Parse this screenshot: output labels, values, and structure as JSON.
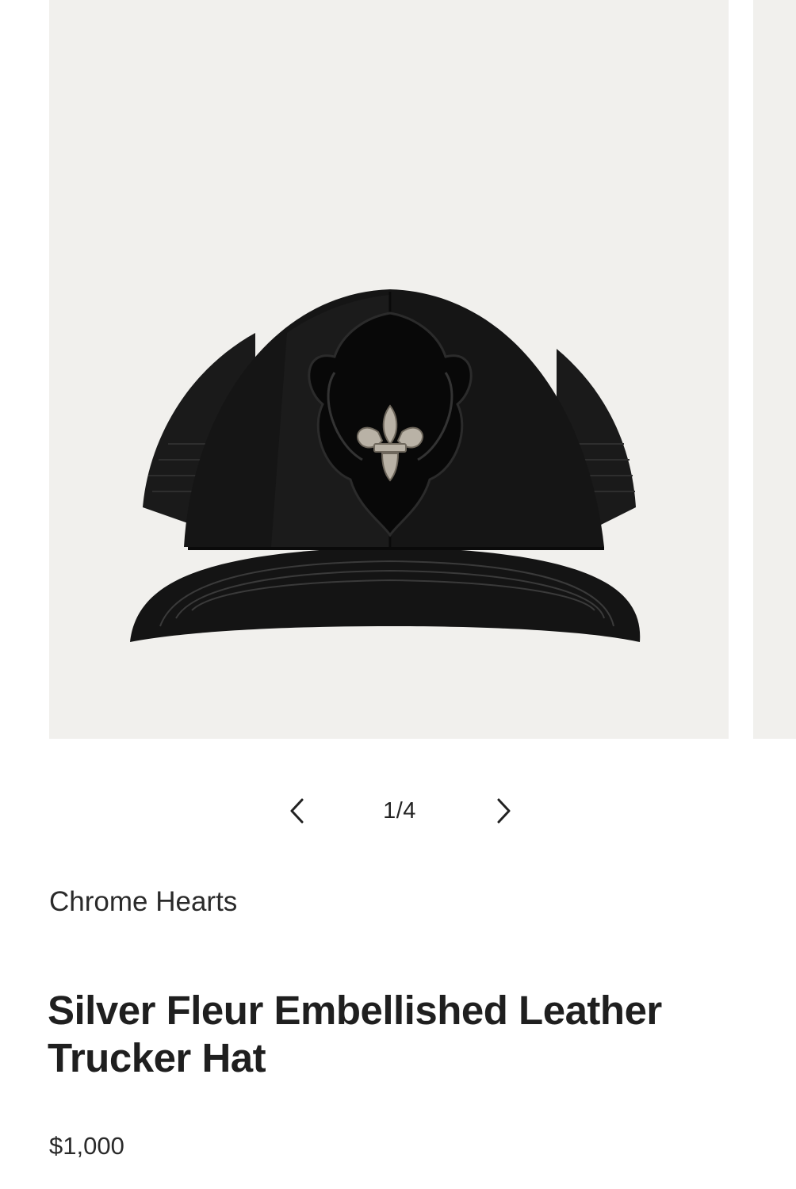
{
  "carousel": {
    "image_alt": "Silver Fleur Embellished Leather Trucker Hat",
    "prev_icon": "chevron-left-icon",
    "next_icon": "chevron-right-icon",
    "counter": "1/4"
  },
  "product": {
    "brand": "Chrome Hearts",
    "title": "Silver Fleur Embellished Leather Trucker Hat",
    "price": "$1,000"
  },
  "colors": {
    "image_background": "#f1f0ed",
    "text": "#222222"
  }
}
